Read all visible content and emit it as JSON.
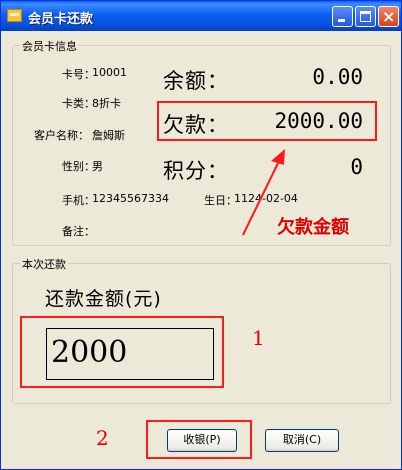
{
  "window": {
    "title": "会员卡还款"
  },
  "titlebar": {
    "min_label": "_",
    "max_label": "□",
    "close_label": "×"
  },
  "card_info": {
    "legend": "会员卡信息",
    "card_no_label": "卡号：",
    "card_no": "10001",
    "card_type_label": "卡类：",
    "card_type": "8折卡",
    "customer_label": "客户名称：",
    "customer": "詹姆斯",
    "gender_label": "性别：",
    "gender": "男",
    "phone_label": "手机：",
    "phone": "12345567334",
    "birthday_label": "生日：",
    "birthday": "1124-02-04",
    "notes_label": "备注：",
    "notes": "",
    "balance_label": "余额：",
    "balance": "0.00",
    "debt_label": "欠款：",
    "debt": "2000.00",
    "points_label": "积分：",
    "points": "0"
  },
  "repayment": {
    "legend": "本次还款",
    "amount_label": "还款金额(元)",
    "amount_value": "2000"
  },
  "buttons": {
    "collect": "收银(P)",
    "cancel": "取消(C)"
  },
  "annotations": {
    "debt_caption": "欠款金额",
    "step1": "1",
    "step2": "2"
  },
  "colors": {
    "annotation": "#ff1a1a",
    "titlebar": "#0a5ff5"
  }
}
